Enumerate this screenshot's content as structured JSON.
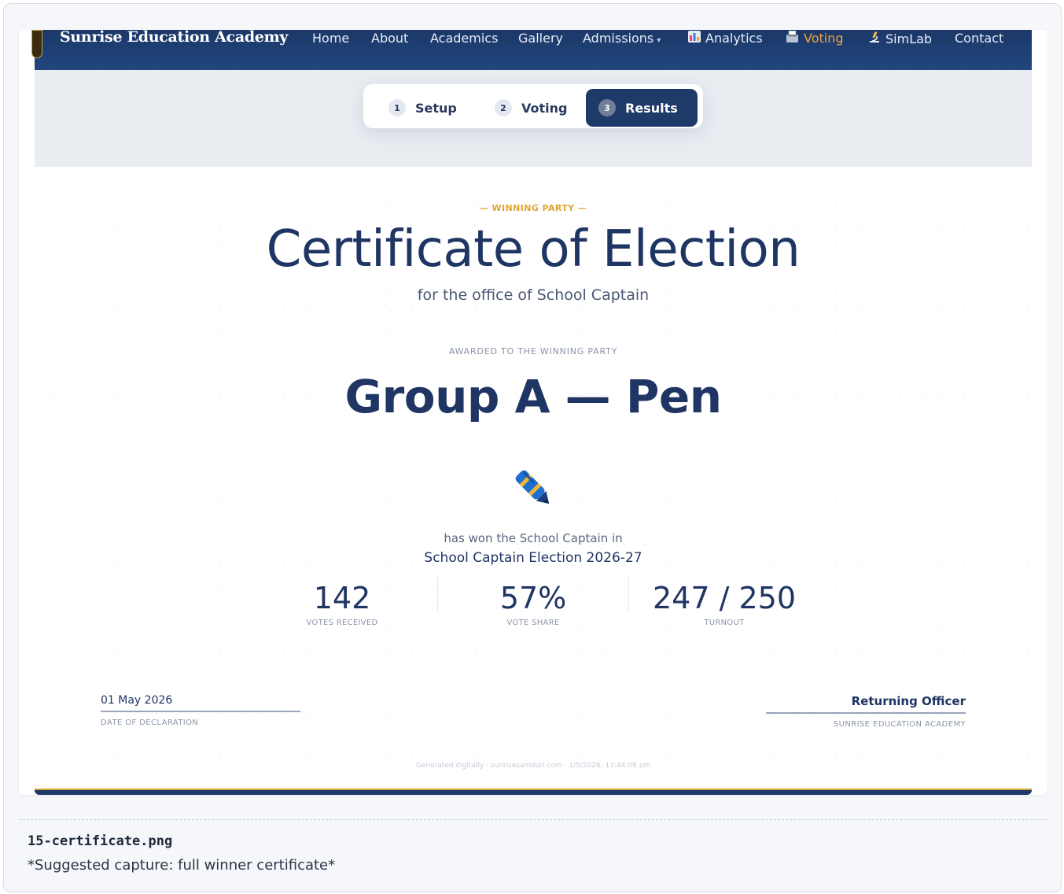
{
  "header": {
    "brand": "Sunrise Education Academy",
    "nav": [
      {
        "label": "Home"
      },
      {
        "label": "About"
      },
      {
        "label": "Academics"
      },
      {
        "label": "Gallery"
      },
      {
        "label": "Admissions",
        "has_dropdown": true
      },
      {
        "label": "Analytics",
        "icon": "bar-chart-icon"
      },
      {
        "label": "Voting",
        "icon": "ballot-box-icon",
        "active": true
      },
      {
        "label": "SimLab",
        "icon": "microscope-icon"
      },
      {
        "label": "Contact"
      }
    ]
  },
  "stepper": {
    "steps": [
      {
        "num": "1",
        "label": "Setup"
      },
      {
        "num": "2",
        "label": "Voting"
      },
      {
        "num": "3",
        "label": "Results",
        "active": true
      }
    ]
  },
  "certificate": {
    "kicker": "— WINNING PARTY —",
    "title": "Certificate of Election",
    "subtitle": "for the office of School Captain",
    "awarded_label": "AWARDED TO THE WINNING PARTY",
    "winner": "Group A — Pen",
    "winner_icon": "pen-icon",
    "won_line": "has won the School Captain in",
    "election_name": "School Captain Election 2026-27",
    "stats": [
      {
        "value": "142",
        "label": "VOTES RECEIVED"
      },
      {
        "value": "57%",
        "label": "VOTE SHARE"
      },
      {
        "value": "247 / 250",
        "label": "TURNOUT"
      }
    ],
    "date_value": "01 May 2026",
    "date_label": "DATE OF DECLARATION",
    "officer_value": "Returning Officer",
    "officer_label": "SUNRISE EDUCATION ACADEMY",
    "footer_note": "Generated digitally · sunrisesamdari.com · 1/5/2026, 11:44:08 pm"
  },
  "caption": {
    "filename": "15-certificate.png",
    "note": "*Suggested capture: full winner certificate*"
  },
  "colors": {
    "navy": "#1f3563",
    "nav_bg": "#1b3868",
    "accent_orange": "#f0a33a",
    "gold": "#d4a437"
  }
}
